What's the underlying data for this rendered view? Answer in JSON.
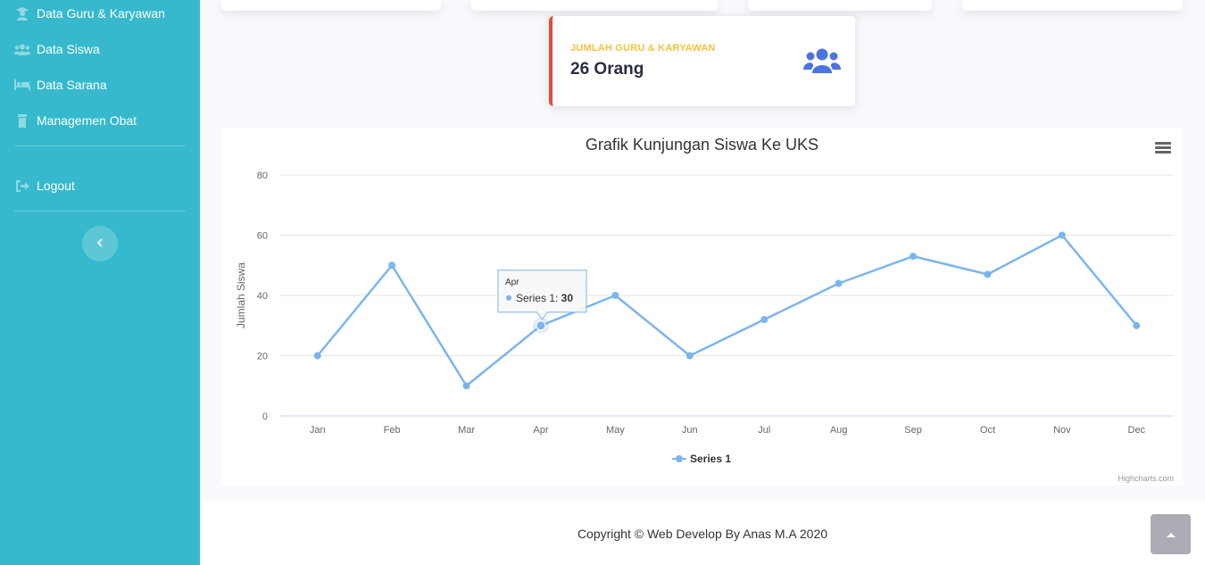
{
  "sidebar": {
    "items": [
      {
        "label": "Data Guru & Karyawan",
        "icon": "user-graduate-icon"
      },
      {
        "label": "Data Siswa",
        "icon": "users-icon"
      },
      {
        "label": "Data Sarana",
        "icon": "bed-icon"
      },
      {
        "label": "Managemen Obat",
        "icon": "medicine-bottle-icon"
      }
    ],
    "logout": {
      "label": "Logout",
      "icon": "sign-out-icon"
    },
    "toggle_icon": "chevron-left-icon"
  },
  "stat_card": {
    "label": "JUMLAH GURU & KARYAWAN",
    "value": "26 Orang",
    "icon": "users-icon",
    "border_color": "#e74a3b",
    "label_color": "#f6c23e",
    "icon_color": "#4e73df"
  },
  "chart": {
    "menu_icon": "hamburger-menu-icon",
    "credits": "Highcharts.com"
  },
  "chart_data": {
    "type": "line",
    "title": "Grafik Kunjungan Siswa Ke UKS",
    "xlabel": "",
    "ylabel": "Jumlah Siswa",
    "categories": [
      "Jan",
      "Feb",
      "Mar",
      "Apr",
      "May",
      "Jun",
      "Jul",
      "Aug",
      "Sep",
      "Oct",
      "Nov",
      "Dec"
    ],
    "series": [
      {
        "name": "Series 1",
        "values": [
          20,
          50,
          10,
          30,
          40,
          20,
          32,
          44,
          53,
          47,
          60,
          30
        ],
        "color": "#7cb5ec"
      }
    ],
    "ylim": [
      0,
      80
    ],
    "yticks": [
      0,
      20,
      40,
      60,
      80
    ],
    "grid": true,
    "legend": "bottom-center",
    "tooltip": {
      "category": "Apr",
      "series": "Series 1",
      "value": "30"
    }
  },
  "footer": {
    "copyright": "Copyright © Web Develop By Anas M.A 2020"
  },
  "scroll_top_icon": "chevron-up-icon"
}
